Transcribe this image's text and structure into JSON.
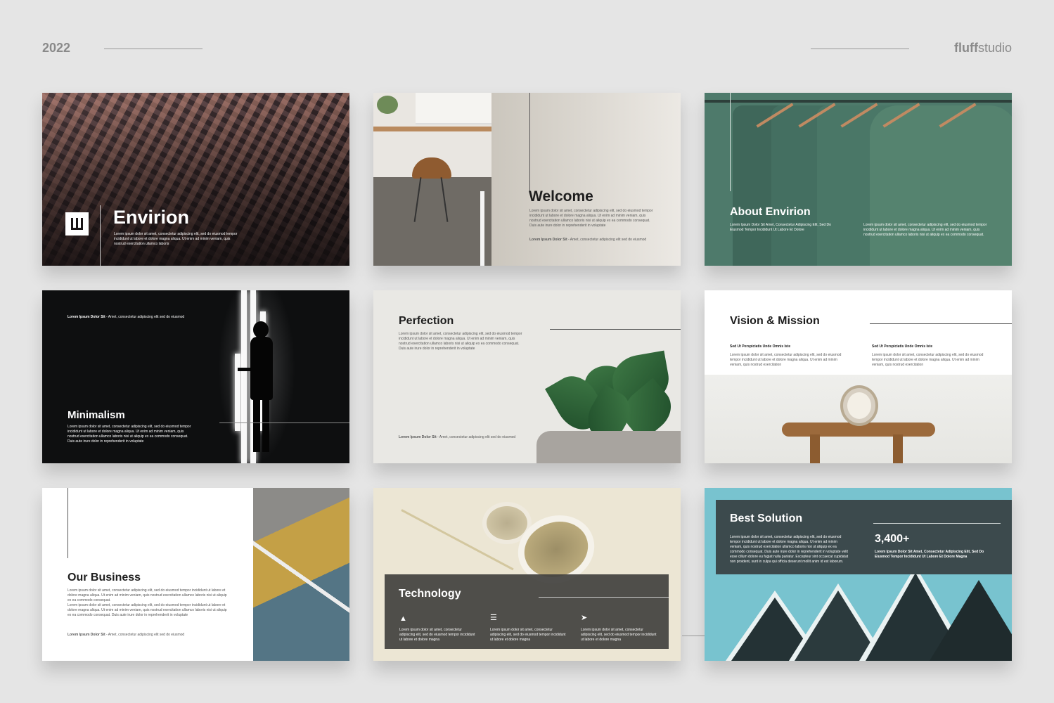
{
  "header": {
    "year": "2022",
    "brand_bold": "fluff",
    "brand_rest": "studio"
  },
  "slides": {
    "s1": {
      "title": "Envirion",
      "text": "Lorem ipsum dolor sit amet, consectetur adipiscing elit, sed do eiusmod tempor incididunt ut labore et dolore magna aliqua. Ut enim ad minim veniam, quis nostrud exercitation ullamco laboris"
    },
    "s2": {
      "title": "Welcome",
      "text": "Lorem ipsum dolor sit amet, consectetur adipiscing elit, sed do eiusmod tempor incididunt ut labore et dolore magna aliqua. Ut enim ad minim veniam, quis nostrud exercitation ullamco laboris nisi ut aliquip ex ea commodo consequat. Duis aute irure dolor in reprehenderit in voluptate",
      "footer_bold": "Lorem Ipsum Dolor Sit",
      "footer_rest": " - Amet, consectetur adipiscing elit sed do eiusmod"
    },
    "s3": {
      "title": "About Envirion",
      "sub": "Lorem Ipsum Dolor Sit Amet, Consectetur Adipiscing Elit, Sed Do Eiusmod Tempor Incididunt Ut Labore Et Dolore",
      "text": "Lorem ipsum dolor sit amet, consectetur adipiscing elit, sed do eiusmod tempor incididunt ut labore et dolore magna aliqua. Ut enim ad minim veniam, quis nostrud exercitation ullamco laboris nisi ut aliquip ex ea commodo consequat."
    },
    "s4": {
      "top_bold": "Lorem Ipsum Dolor Sit",
      "top_rest": " - Amet, consectetur adipiscing elit sed do eiusmod",
      "title": "Minimalism",
      "text": "Lorem ipsum dolor sit amet, consectetur adipiscing elit, sed do eiusmod tempor incididunt ut labore et dolore magna aliqua. Ut enim ad minim veniam, quis nostrud exercitation ullamco laboris nisi ut aliquip ex ea commodo consequat. Duis aute irure dolor in reprehenderit in voluptate"
    },
    "s5": {
      "title": "Perfection",
      "text": "Lorem ipsum dolor sit amet, consectetur adipiscing elit, sed do eiusmod tempor incididunt ut labore et dolore magna aliqua. Ut enim ad minim veniam, quis nostrud exercitation ullamco laboris nisi ut aliquip ex ea commodo consequat. Duis aute irure dolor in reprehenderit in voluptate",
      "footer_bold": "Lorem Ipsum Dolor Sit",
      "footer_rest": " - Amet, consectetur adipiscing elit sed do eiusmod"
    },
    "s6": {
      "title": "Vision & Mission",
      "col1_head": "Sed Ut Perspiciatis Unde Omnis Iste",
      "col1_text": "Lorem ipsum dolor sit amet, consectetur adipiscing elit, sed do eiusmod tempor incididunt ut labore et dolore magna aliqua. Ut enim ad minim veniam, quis nostrud exercitation",
      "col2_head": "Sed Ut Perspiciatis Unde Omnis Iste",
      "col2_text": "Lorem ipsum dolor sit amet, consectetur adipiscing elit, sed do eiusmod tempor incididunt ut labore et dolore magna aliqua. Ut enim ad minim veniam, quis nostrud exercitation"
    },
    "s7": {
      "title": "Our Business",
      "text1": "Lorem ipsum dolor sit amet, consectetur adipiscing elit, sed do eiusmod tempor incididunt ut labore et dolore magna aliqua. Ut enim ad minim veniam, quis nostrud exercitation ullamco laboris nisi ut aliquip ex ea commodo consequat.",
      "text2": "Lorem ipsum dolor sit amet, consectetur adipiscing elit, sed do eiusmod tempor incididunt ut labore et dolore magna aliqua. Ut enim ad minim veniam, quis nostrud exercitation ullamco laboris nisi ut aliquip ex ea commodo consequat. Duis aute irure dolor in reprehenderit in voluptate",
      "footer_bold": "Lorem Ipsum Dolor Sit",
      "footer_rest": " - Amet, consectetur adipiscing elit sed do eiusmod"
    },
    "s8": {
      "title": "Technology",
      "items": [
        "Lorem ipsum dolor sit amet, consectetur adipiscing elit, sed do eiusmod tempor incididunt ut labore et dolore magna",
        "Lorem ipsum dolor sit amet, consectetur adipiscing elit, sed do eiusmod tempor incididunt ut labore et dolore magna",
        "Lorem ipsum dolor sit amet, consectetur adipiscing elit, sed do eiusmod tempor incididunt ut labore et dolore magna"
      ],
      "icons": [
        "megaphone-icon",
        "server-icon",
        "rocket-icon"
      ]
    },
    "s9": {
      "title": "Best Solution",
      "text": "Lorem ipsum dolor sit amet, consectetur adipiscing elit, sed do eiusmod tempor incididunt ut labore et dolore magna aliqua. Ut enim ad minim veniam, quis nostrud exercitation ullamco laboris nisi ut aliquip ex ea commodo consequat. Duis aute irure dolor in reprehenderit in voluptate velit esse cillum dolore eu fugiat nulla pariatur. Excepteur sint occaecat cupidatat non proident, sunt in culpa qui officia deserunt mollit anim id est laborum.",
      "stat": "3,400+",
      "stat_text": "Lorem Ipsum Dolor Sit Amet, Consectetur Adipiscing Elit, Sed Do Eiusmod Tempor Incididunt Ut Labore Et Dolore Magna"
    }
  }
}
